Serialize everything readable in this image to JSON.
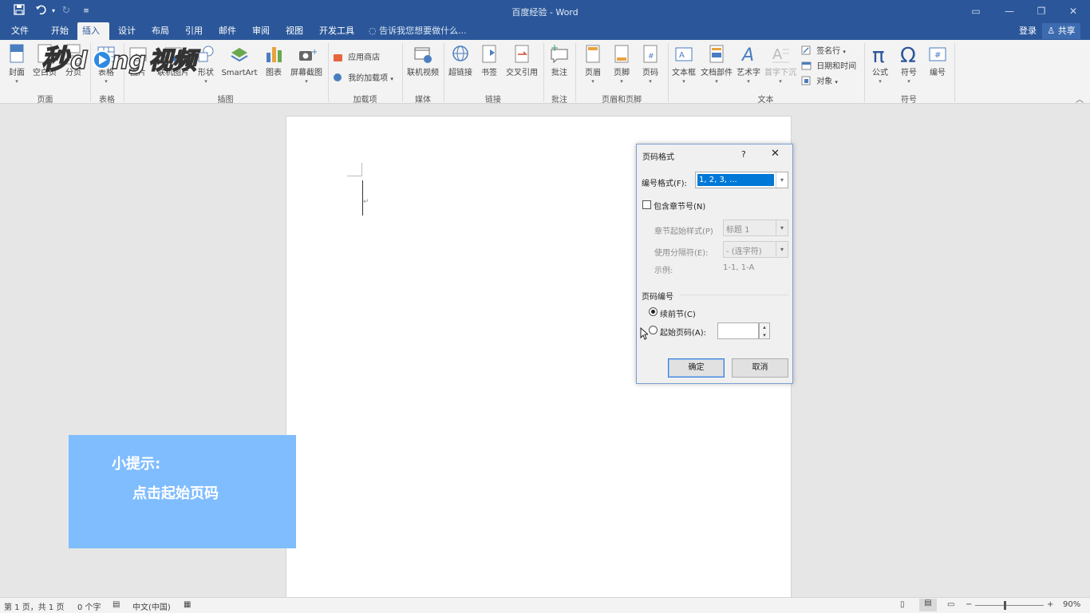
{
  "window": {
    "title": "百度经验 - Word"
  },
  "quick_access": {
    "save": "save-icon",
    "undo": "undo-icon",
    "redo": "redo-icon",
    "customize": "customize-icon"
  },
  "tabs": [
    {
      "label": "文件"
    },
    {
      "label": "开始"
    },
    {
      "label": "插入"
    },
    {
      "label": "设计"
    },
    {
      "label": "布局"
    },
    {
      "label": "引用"
    },
    {
      "label": "邮件"
    },
    {
      "label": "审阅"
    },
    {
      "label": "视图"
    },
    {
      "label": "开发工具"
    }
  ],
  "tell_me": "告诉我您想要做什么...",
  "account": {
    "login": "登录",
    "share": "共享"
  },
  "watermark": "秒懂视频",
  "ribbon": {
    "buttons": {
      "cover": "封面",
      "blank_page": "空白页",
      "page_break": "分页",
      "table": "表格",
      "picture": "图片",
      "online_picture": "联机图片",
      "shapes": "形状",
      "smartart": "SmartArt",
      "chart": "图表",
      "screenshot": "屏幕截图",
      "store": "应用商店",
      "my_addins": "我的加载项",
      "online_video": "联机视频",
      "hyperlink": "超链接",
      "bookmark": "书签",
      "cross_ref": "交叉引用",
      "comment": "批注",
      "header": "页眉",
      "footer": "页脚",
      "page_number": "页码",
      "textbox": "文本框",
      "quick_parts": "文档部件",
      "wordart": "艺术字",
      "dropcap": "首字下沉",
      "signature": "签名行",
      "datetime": "日期和时间",
      "object": "对象",
      "equation": "公式",
      "symbol": "符号",
      "numbering": "编号"
    },
    "groups": {
      "pages": "页面",
      "tables": "表格",
      "illustrations": "插图",
      "addins": "加载项",
      "media": "媒体",
      "links": "链接",
      "comments": "批注",
      "header_footer": "页眉和页脚",
      "text": "文本",
      "symbols": "符号"
    }
  },
  "dialog": {
    "title": "页码格式",
    "help": "?",
    "number_format_label": "编号格式(F):",
    "number_format_value": "1, 2, 3, ...",
    "include_chapter_label": "包含章节号(N)",
    "include_chapter_checked": false,
    "chapter_style_label": "章节起始样式(P)",
    "chapter_style_value": "标题 1",
    "separator_label": "使用分隔符(E):",
    "separator_value": "-  (连字符)",
    "example_label": "示例:",
    "example_value": "1-1, 1-A",
    "numbering_section": "页码编号",
    "continue_label": "续前节(C)",
    "start_at_label": "起始页码(A):",
    "start_at_value": "",
    "selected_option": "continue",
    "ok": "确定",
    "cancel": "取消"
  },
  "tip": {
    "heading": "小提示:",
    "body": "点击起始页码"
  },
  "status": {
    "page": "第 1 页，共 1 页",
    "words": "0 个字",
    "language": "中文(中国)",
    "zoom": "90%"
  },
  "colors": {
    "brand": "#2b579a",
    "tip_bg": "#80bdff",
    "selection": "#0078d7"
  }
}
